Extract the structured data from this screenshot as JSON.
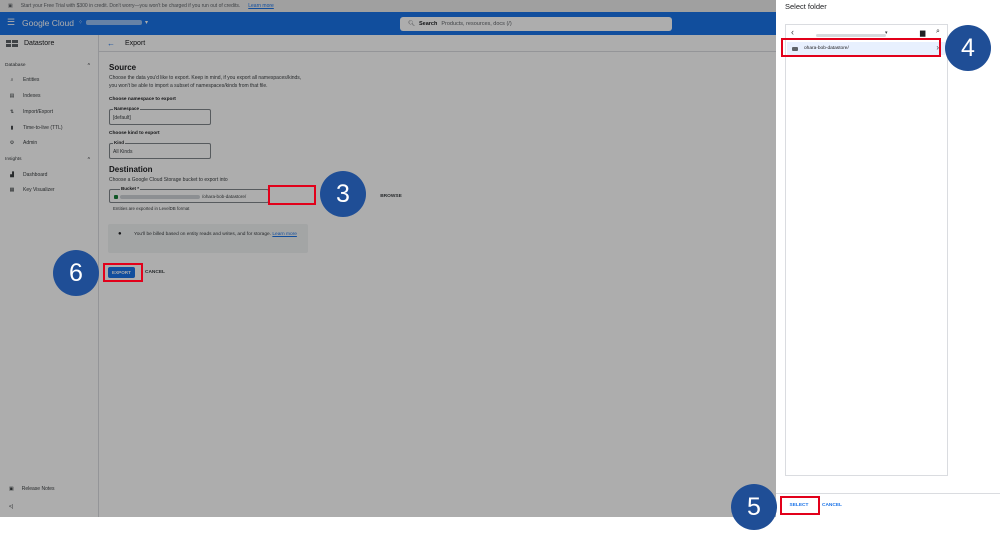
{
  "promo": {
    "text": "Start your Free Trial with $300 in credit. Don't worry—you won't be charged if you run out of credits.",
    "link": "Learn more"
  },
  "topbar": {
    "brand": "Google Cloud",
    "search_label": "Search",
    "search_placeholder": "Products, resources, docs (/)"
  },
  "sidebar": {
    "title": "Datastore",
    "sections": [
      {
        "label": "Database",
        "items": [
          "Entities",
          "Indexes",
          "Import/Export",
          "Time-to-live (TTL)",
          "Admin"
        ]
      },
      {
        "label": "Insights",
        "items": [
          "Dashboard",
          "Key Visualizer"
        ]
      }
    ],
    "footer": [
      "Release Notes",
      "<|"
    ]
  },
  "page": {
    "title": "Export",
    "source_heading": "Source",
    "source_desc_1": "Choose the data you'd like to export. Keep in mind, if you export all namespaces/kinds,",
    "source_desc_2": "you won't be able to import a subset of namespaces/kinds from that file.",
    "ns_heading": "Choose namespace to export",
    "ns_label": "Namespace",
    "ns_value": "[default]",
    "kind_heading": "Choose kind to export",
    "kind_label": "Kind",
    "kind_value": "All Kinds",
    "dest_heading": "Destination",
    "dest_desc": "Choose a Google Cloud Storage bucket to export into",
    "bucket_label": "Bucket *",
    "bucket_value": "/ohara-bob-datastore/",
    "bucket_hint": "Entities are exported in LevelDB format",
    "browse": "BROWSE",
    "note_text": "You'll be billed based on entity reads and writes, and for storage.",
    "note_link": "Learn more",
    "export": "EXPORT",
    "cancel": "CANCEL"
  },
  "panel": {
    "title": "Select folder",
    "folder": "ohara-bob-datastore/",
    "select": "SELECT",
    "cancel": "CANCEL"
  },
  "badges": [
    "3",
    "4",
    "5",
    "6"
  ],
  "colors": {
    "brand_blue": "#1a73e8",
    "badge_blue": "#1f4e96",
    "highlight_red": "#e2001a"
  }
}
